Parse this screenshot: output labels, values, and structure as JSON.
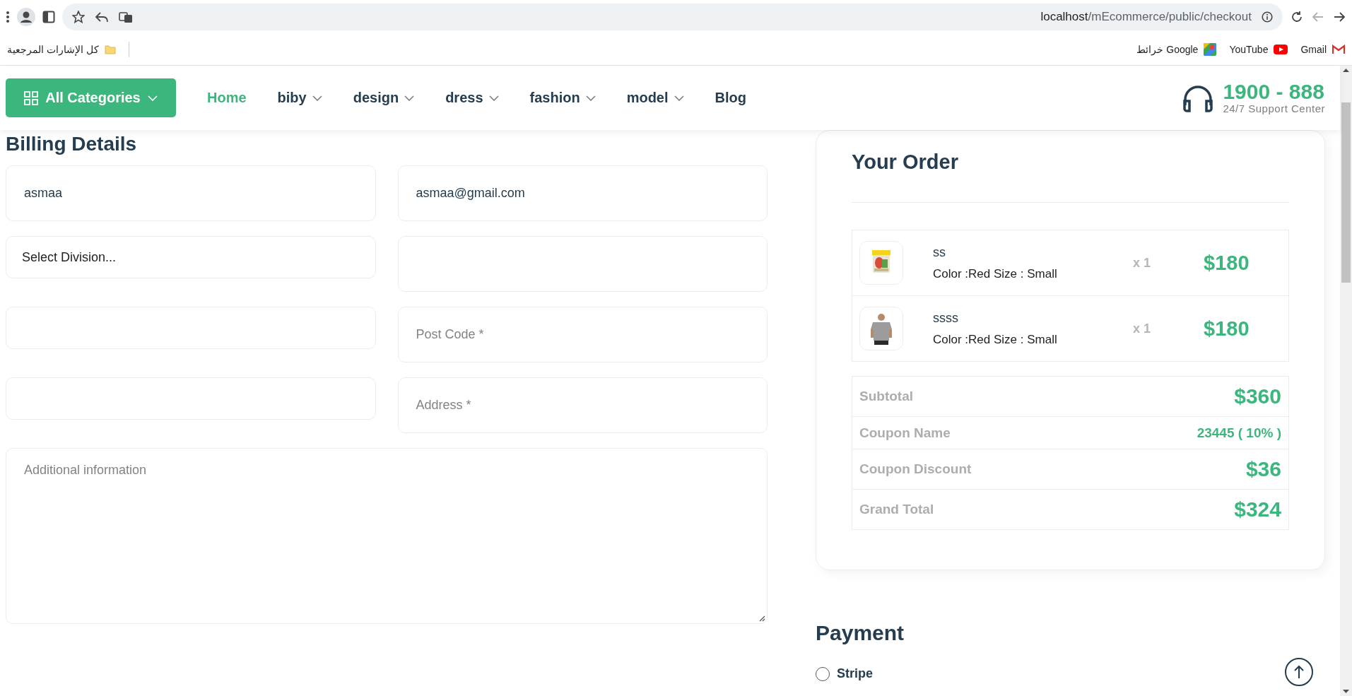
{
  "browser": {
    "url_host": "localhost",
    "url_path": "/mEcommerce/public/checkout",
    "all_bookmarks": "كل الإشارات المرجعية",
    "bookmarks": [
      {
        "label": "خرائط Google",
        "kind": "maps"
      },
      {
        "label": "YouTube",
        "kind": "youtube"
      },
      {
        "label": "Gmail",
        "kind": "gmail"
      }
    ]
  },
  "header": {
    "categories_button": "All Categories",
    "nav": [
      {
        "label": "Home",
        "selected": true,
        "dropdown": false
      },
      {
        "label": "biby",
        "selected": false,
        "dropdown": true
      },
      {
        "label": "design",
        "selected": false,
        "dropdown": true
      },
      {
        "label": "dress",
        "selected": false,
        "dropdown": true
      },
      {
        "label": "fashion",
        "selected": false,
        "dropdown": true
      },
      {
        "label": "model",
        "selected": false,
        "dropdown": true
      },
      {
        "label": "Blog",
        "selected": false,
        "dropdown": false
      }
    ],
    "phone": "1900 - 888",
    "support": "24/7 Support Center"
  },
  "billing": {
    "title": "Billing Details",
    "fields": [
      {
        "kind": "input",
        "value": "asmaa"
      },
      {
        "kind": "input",
        "value": "asmaa@gmail.com"
      },
      {
        "kind": "select",
        "value": "Select Division..."
      },
      {
        "kind": "input"
      },
      {
        "kind": "input"
      },
      {
        "kind": "input",
        "placeholder": "Post Code *"
      },
      {
        "kind": "input"
      },
      {
        "kind": "input",
        "placeholder": "Address *"
      }
    ],
    "notes": {
      "placeholder": "Additional information"
    }
  },
  "order": {
    "title": "Your Order",
    "items": [
      {
        "name": "ss",
        "variant": "Color :Red Size : Small",
        "qty": "x 1",
        "price": "$180",
        "kind": "picture"
      },
      {
        "name": "ssss",
        "variant": "Color :Red Size : Small",
        "qty": "x 1",
        "price": "$180",
        "kind": "picture"
      }
    ],
    "totals": [
      {
        "label": "Subtotal",
        "value": "$360",
        "kind": "amount"
      },
      {
        "label": "Coupon Name",
        "value": "23445 ( 10% )",
        "kind": "code"
      },
      {
        "label": "Coupon Discount",
        "value": "$36",
        "kind": "amount"
      },
      {
        "label": "Grand Total",
        "value": "$324",
        "kind": "amount"
      }
    ]
  },
  "payment": {
    "title": "Payment",
    "options": [
      {
        "label": "Stripe",
        "selected": false
      }
    ]
  }
}
